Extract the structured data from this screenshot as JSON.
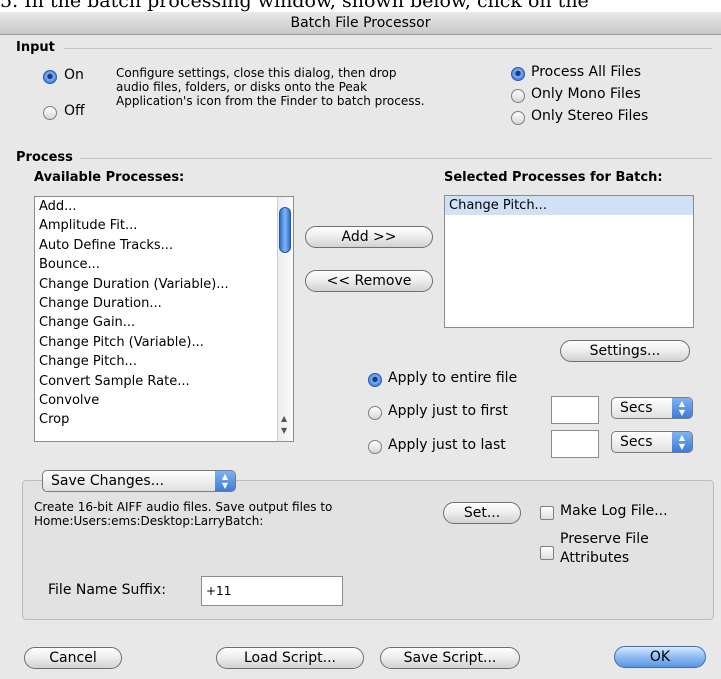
{
  "top_caption": "5.  In the batch processing window, shown below, click on the",
  "window": {
    "title": "Batch File Processor"
  },
  "input": {
    "label": "Input",
    "on_label": "On",
    "off_label": "Off",
    "on_selected": true,
    "description": "Configure settings, close this dialog, then drop audio files, folders, or disks onto the Peak Application's icon from the Finder to batch process.",
    "description_lines": [
      "Configure settings, close this dialog, then drop",
      "audio files, folders, or disks onto the Peak",
      "Application's icon from the Finder to batch process."
    ],
    "file_options": [
      "Process All Files",
      "Only Mono Files",
      "Only Stereo Files"
    ],
    "file_option_selected": 0
  },
  "process": {
    "label": "Process",
    "available_label": "Available Processes:",
    "selected_label": "Selected Processes for Batch:",
    "available": [
      "Add...",
      "Amplitude Fit...",
      "Auto Define Tracks...",
      "Bounce...",
      "Change Duration (Variable)...",
      "Change Duration...",
      "Change Gain...",
      "Change Pitch (Variable)...",
      "Change Pitch...",
      "Convert Sample Rate...",
      "Convolve",
      "Crop"
    ],
    "selected": [
      "Change Pitch..."
    ],
    "add_button": "Add >>",
    "remove_button": "<< Remove",
    "settings_button": "Settings...",
    "apply_options": [
      "Apply to entire file",
      "Apply just to first",
      "Apply just to last"
    ],
    "apply_selected": 0,
    "unit_first": "Secs",
    "unit_last": "Secs",
    "first_value": "",
    "last_value": ""
  },
  "save": {
    "popup_value": "Save Changes...",
    "description_lines": [
      "Create 16-bit AIFF audio files.  Save output files to",
      "Home:Users:ems:Desktop:LarryBatch:"
    ],
    "set_button": "Set...",
    "make_log_label": "Make Log File...",
    "preserve_label_lines": [
      "Preserve File",
      "Attributes"
    ],
    "suffix_label": "File Name Suffix:",
    "suffix_value": "+11"
  },
  "footer": {
    "cancel": "Cancel",
    "load_script": "Load Script...",
    "save_script": "Save Script...",
    "ok": "OK"
  }
}
